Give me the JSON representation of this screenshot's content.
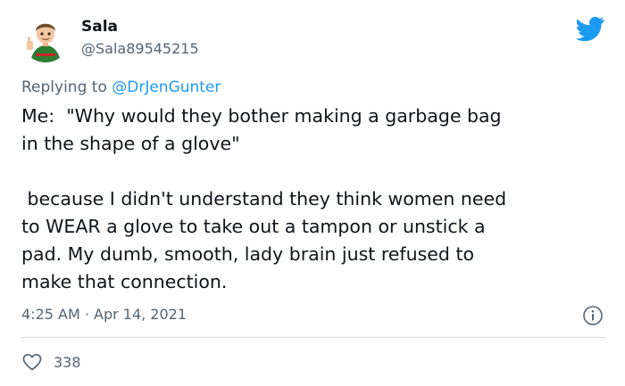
{
  "author": {
    "display_name": "Sala",
    "handle": "@Sala89545215"
  },
  "reply": {
    "prefix": "Replying to ",
    "mention": "@DrJenGunter"
  },
  "tweet": {
    "text": "Me:  \"Why would they bother making a garbage bag\nin the shape of a glove\"\n\n because I didn't understand they think women need\nto WEAR a glove to take out a tampon or unstick a\npad. My dumb, smooth, lady brain just refused to\nmake that connection.",
    "timestamp": "4:25 AM · Apr 14, 2021",
    "like_count": "338"
  },
  "icons": {
    "brand": "twitter-bird-icon",
    "info": "info-icon",
    "like": "heart-icon"
  },
  "colors": {
    "brand_blue": "#1d9bf0",
    "text_primary": "#0f1419",
    "text_secondary": "#536471",
    "divider": "#cfd9de"
  }
}
